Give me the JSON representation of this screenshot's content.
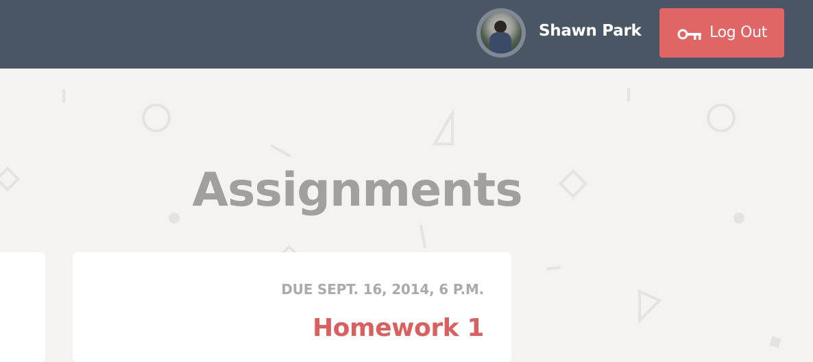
{
  "header": {
    "user_name": "Shawn Park",
    "logout_label": "Log Out",
    "accent_color": "#e06666",
    "bar_color": "#4b5665"
  },
  "main": {
    "title": "Assignments",
    "assignments": [
      {
        "due": "DUE SEPT. 16, 2014, 6 P.M.",
        "title": "Homework 1"
      }
    ]
  },
  "icons": {
    "logout": "key-icon",
    "avatar": "user-avatar-photo"
  }
}
